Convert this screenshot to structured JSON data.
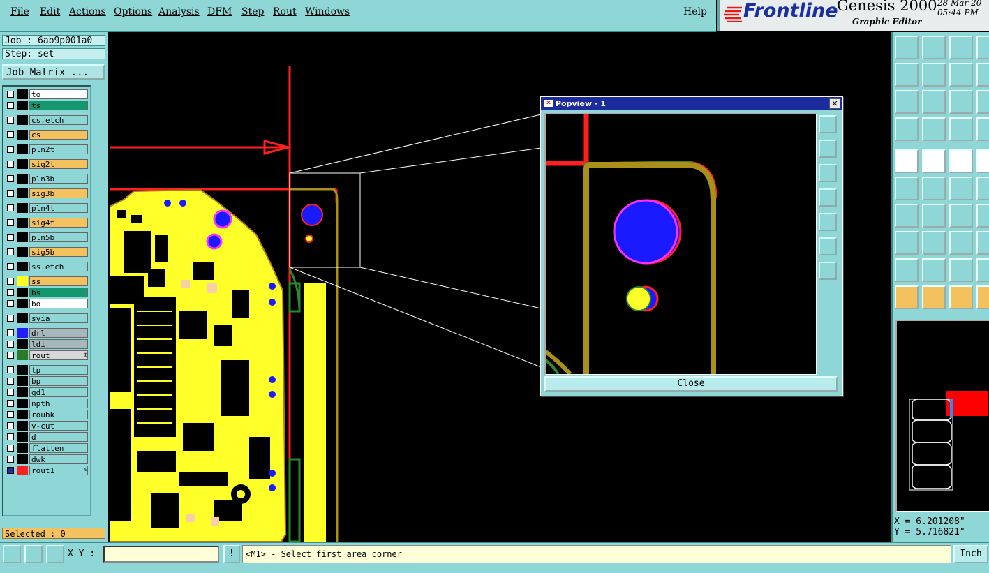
{
  "menu": [
    "File",
    "Edit",
    "Actions",
    "Options",
    "Analysis",
    "DFM",
    "Step",
    "Rout",
    "Windows"
  ],
  "help": "Help",
  "brand": {
    "logo": "Frontline",
    "title": "Genesis 2000",
    "subtitle": "Graphic Editor",
    "date": "28 Mar 20",
    "time": "05:44 PM"
  },
  "job": "Job : 6ab9p001a0",
  "step": "Step: set",
  "job_matrix": "Job Matrix ...",
  "layers": [
    {
      "name": "to",
      "color": "#ffffff"
    },
    {
      "name": "ts",
      "color": "#14966e"
    },
    {
      "name": "cs.etch",
      "color": "#8fd6d6"
    },
    {
      "name": "cs",
      "color": "#f3c15d"
    },
    {
      "name": "pln2t",
      "color": "#8fd6d6"
    },
    {
      "name": "sig2t",
      "color": "#f3c15d"
    },
    {
      "name": "pln3b",
      "color": "#8fd6d6"
    },
    {
      "name": "sig3b",
      "color": "#f3c15d"
    },
    {
      "name": "pln4t",
      "color": "#8fd6d6"
    },
    {
      "name": "sig4t",
      "color": "#f3c15d"
    },
    {
      "name": "pln5b",
      "color": "#8fd6d6"
    },
    {
      "name": "sig5b",
      "color": "#f3c15d"
    },
    {
      "name": "ss.etch",
      "color": "#8fd6d6"
    },
    {
      "name": "ss",
      "color": "#f3c15d",
      "swatch": "#ffff20"
    },
    {
      "name": "bs",
      "color": "#14966e"
    },
    {
      "name": "bo",
      "color": "#ffffff"
    },
    {
      "name": "svia",
      "color": "#8fd6d6"
    },
    {
      "name": "drl",
      "color": "#a6b8bc",
      "swatch": "#2020ff"
    },
    {
      "name": "ldi",
      "color": "#a6b8bc"
    },
    {
      "name": "rout",
      "color": "#d8d8d8",
      "swatch": "#2a7a2a",
      "mark": "⊞"
    },
    {
      "name": "tp",
      "color": "#8fd6d6"
    },
    {
      "name": "bp",
      "color": "#8fd6d6"
    },
    {
      "name": "gd1",
      "color": "#8fd6d6"
    },
    {
      "name": "npth",
      "color": "#8fd6d6"
    },
    {
      "name": "roubk",
      "color": "#8fd6d6"
    },
    {
      "name": "v-cut",
      "color": "#8fd6d6"
    },
    {
      "name": "d",
      "color": "#8fd6d6"
    },
    {
      "name": "flatten",
      "color": "#8fd6d6"
    },
    {
      "name": "dwk",
      "color": "#8fd6d6"
    },
    {
      "name": "rout1",
      "color": "#8fd6d6",
      "swatch": "#ff2020",
      "mark": "✎"
    }
  ],
  "selected": "Selected : 0",
  "popview": {
    "title": "Popview - 1",
    "close_label": "Close"
  },
  "coords": {
    "x": "X = 6.201208\"",
    "y": "Y = 5.716821\""
  },
  "bottom": {
    "xy_label": "X Y :",
    "xy_value": "",
    "excl": "!",
    "prompt": "<M1> - Select first area corner",
    "units": "Inch"
  }
}
